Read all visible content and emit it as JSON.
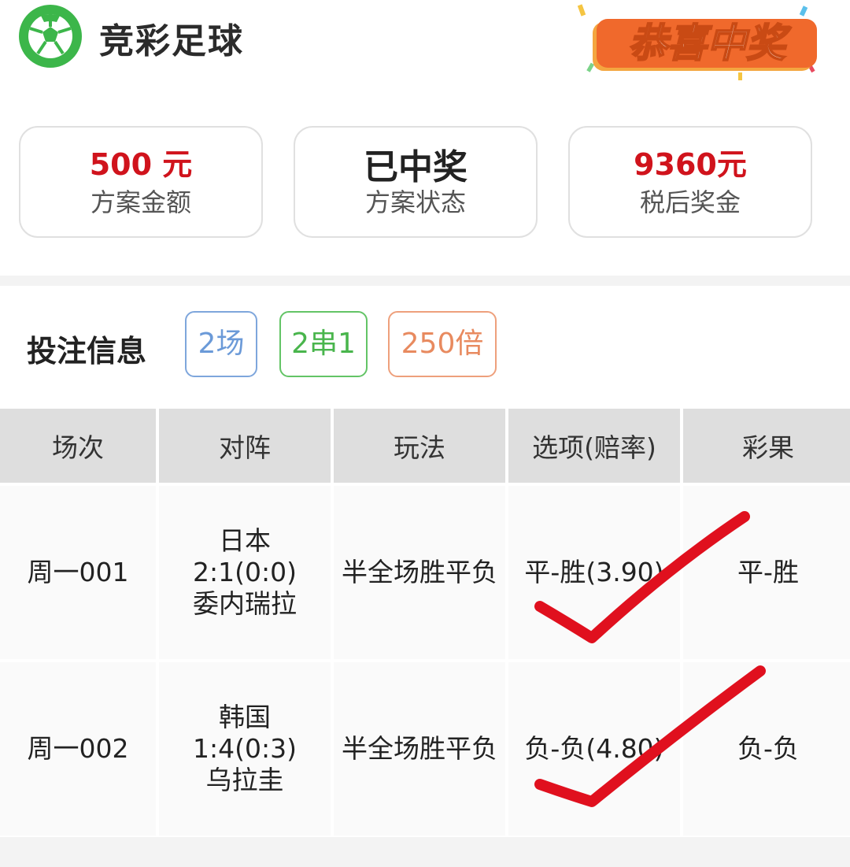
{
  "header": {
    "title": "竞彩足球",
    "banner_text": "恭喜中奖"
  },
  "stats": {
    "amount_value": "500 元",
    "amount_label": "方案金额",
    "status_value": "已中奖",
    "status_label": "方案状态",
    "prize_value": "9360元",
    "prize_label": "税后奖金"
  },
  "bet_info": {
    "title": "投注信息",
    "tags": [
      "2场",
      "2串1",
      "250倍"
    ]
  },
  "table": {
    "headers": [
      "场次",
      "对阵",
      "玩法",
      "选项(赔率)",
      "彩果"
    ],
    "rows": [
      {
        "match_no": "周一001",
        "home": "日本",
        "score": "2:1(0:0)",
        "away": "委内瑞拉",
        "play": "半全场胜平负",
        "option": "平-胜(3.90)",
        "result": "平-胜"
      },
      {
        "match_no": "周一002",
        "home": "韩国",
        "score": "1:4(0:3)",
        "away": "乌拉圭",
        "play": "半全场胜平负",
        "option": "负-负(4.80)",
        "result": "负-负"
      }
    ]
  },
  "colors": {
    "accent_red": "#d0131c",
    "logo_green": "#3cb64a",
    "banner_orange": "#f0692c"
  }
}
